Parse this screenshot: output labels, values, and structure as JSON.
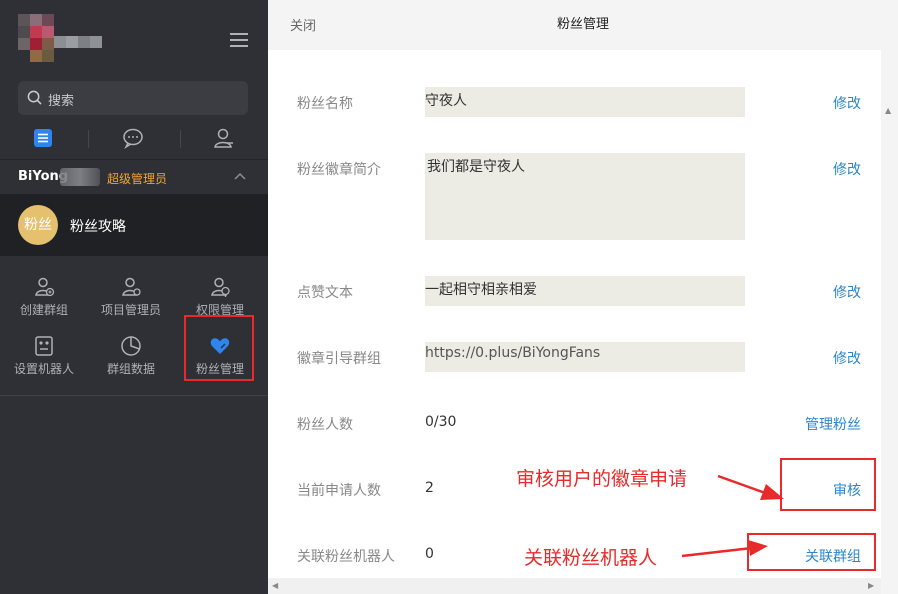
{
  "sidebar": {
    "search_placeholder": "搜索",
    "user": {
      "name": "BiYong",
      "role": "超级管理员"
    },
    "group": {
      "avatar_text": "粉丝",
      "name": "粉丝攻略"
    },
    "menu": [
      {
        "label": "创建群组",
        "icon": "create-group-icon"
      },
      {
        "label": "项目管理员",
        "icon": "project-admin-icon"
      },
      {
        "label": "权限管理",
        "icon": "permission-icon"
      },
      {
        "label": "设置机器人",
        "icon": "robot-icon"
      },
      {
        "label": "群组数据",
        "icon": "pie-chart-icon"
      },
      {
        "label": "粉丝管理",
        "icon": "heart-icon"
      }
    ],
    "colors": {
      "bg": "#2e3035",
      "accent": "#2d86f0",
      "role": "#f4a52b"
    }
  },
  "header": {
    "close_label": "关闭",
    "title": "粉丝管理"
  },
  "form": {
    "fan_name": {
      "label": "粉丝名称",
      "value": "守夜人",
      "action": "修改"
    },
    "badge_intro": {
      "label": "粉丝徽章简介",
      "value": "我们都是守夜人",
      "action": "修改"
    },
    "like_text": {
      "label": "点赞文本",
      "value": "一起相守相亲相爱",
      "action": "修改"
    },
    "guide_group": {
      "label": "徽章引导群组",
      "value": "https://0.plus/BiYongFans",
      "action": "修改"
    },
    "fan_count": {
      "label": "粉丝人数",
      "value": "0/30",
      "action": "管理粉丝"
    },
    "applicants": {
      "label": "当前申请人数",
      "value": "2",
      "action": "审核"
    },
    "linked_bot": {
      "label": "关联粉丝机器人",
      "value": "0",
      "action": "关联群组"
    }
  },
  "annotations": {
    "review": "审核用户的徽章申请",
    "link": "关联粉丝机器人",
    "color": "#e82a2a"
  },
  "link_color": "#2d86c8"
}
